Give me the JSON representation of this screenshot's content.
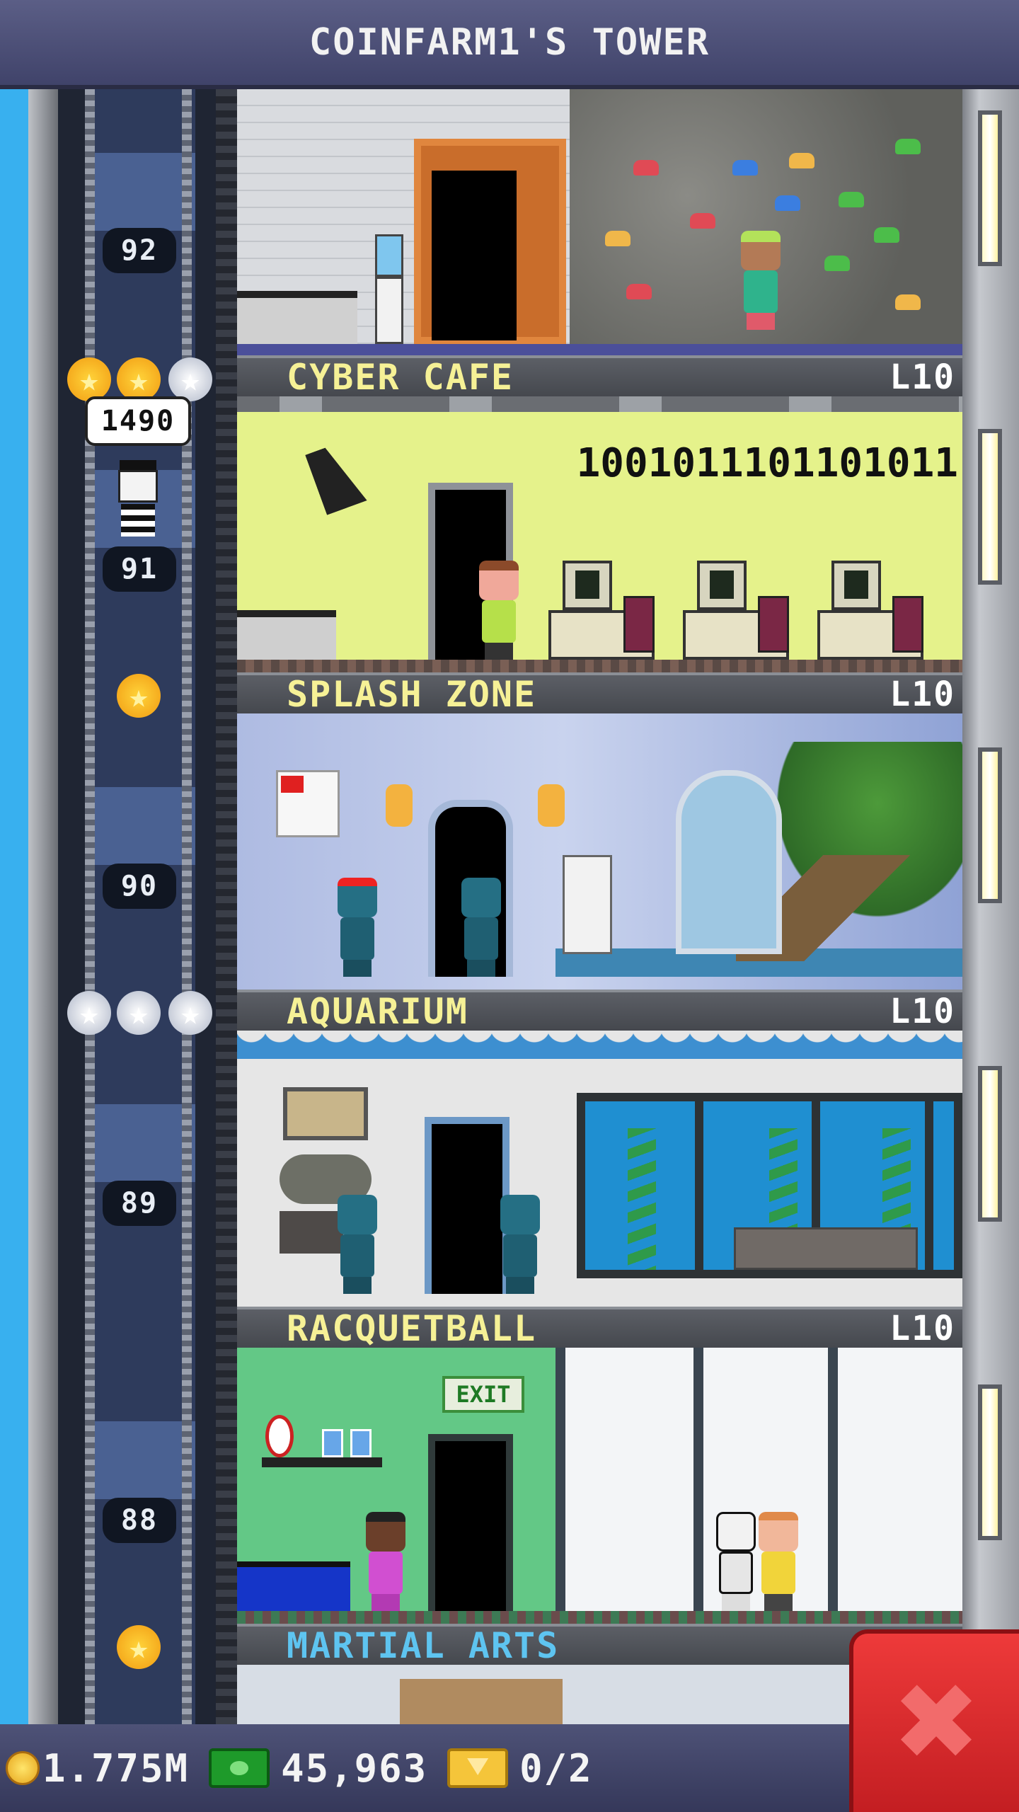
{
  "header": {
    "title": "COINFARM1'S TOWER"
  },
  "elevator": {
    "floor_numbers": [
      "92",
      "91",
      "90",
      "89",
      "88"
    ],
    "bubble_text": "1490"
  },
  "floors": [
    {
      "name": "CYBER CAFE",
      "level": "L10",
      "binary": "1001011101101011"
    },
    {
      "name": "SPLASH ZONE",
      "level": "L10"
    },
    {
      "name": "AQUARIUM",
      "level": "L10"
    },
    {
      "name": "RACQUETBALL",
      "level": "L10",
      "sign": "EXIT"
    },
    {
      "name": "MARTIAL ARTS",
      "level": ""
    }
  ],
  "status": {
    "coins": "1.775M",
    "bux": "45,963",
    "tickets": "0/2"
  },
  "colors": {
    "floor_label_text": "#f6f196",
    "martial_arts_label": "#5ec4f0",
    "close_button": "#e02a2e"
  },
  "icons": {
    "coins": "coin-icon",
    "bux": "bux-icon",
    "tickets": "ticket-icon",
    "close": "close-icon",
    "star_gold": "gold-star-icon",
    "star_silver": "silver-star-icon"
  }
}
